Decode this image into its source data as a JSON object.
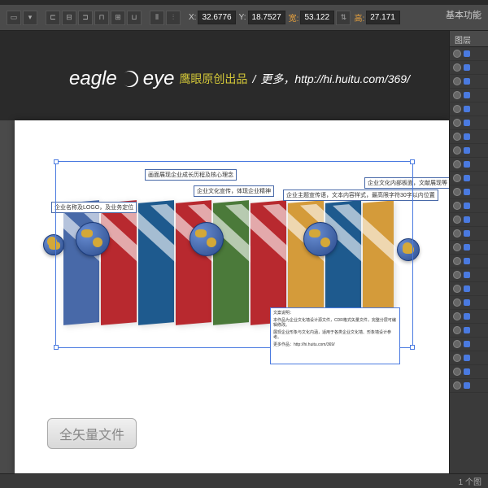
{
  "workspace": "基本功能",
  "toolbar": {
    "x_label": "X:",
    "x_val": "32.6776",
    "y_label": "Y:",
    "y_val": "18.7527",
    "w_label": "宽:",
    "w_val": "53.122",
    "h_label": "高:",
    "h_val": "27.171"
  },
  "logo": {
    "brand_a": "eagle",
    "brand_b": "eye",
    "sub": "鹰眼原创出品",
    "sep": "/",
    "more": "更多，http://hi.huitu.com/369/"
  },
  "callouts": {
    "c1": "画面展现企业成长历程及核心理念",
    "c2": "企业文化宣传，体现企业精神",
    "c3": "企业主题宣传语，文本内容样式，最高限字符30字以内位置",
    "c4": "企业文化内部板面，文献展现等",
    "c5": "企业名称及LOGO，及业务定位"
  },
  "textbox": {
    "l1": "文案说明：",
    "l2": "本作品为企业文化墙设计源文件，CDR格式矢量文件，完整分层可编辑修改。",
    "l3": "展现企业形象与文化内涵，适用于各类企业文化墙、形象墙设计参考。",
    "l4": "更多作品：http://hi.huitu.com/369/"
  },
  "watermark": "全矢量文件",
  "panels": {
    "tab": "图层"
  },
  "status": "1 个图"
}
